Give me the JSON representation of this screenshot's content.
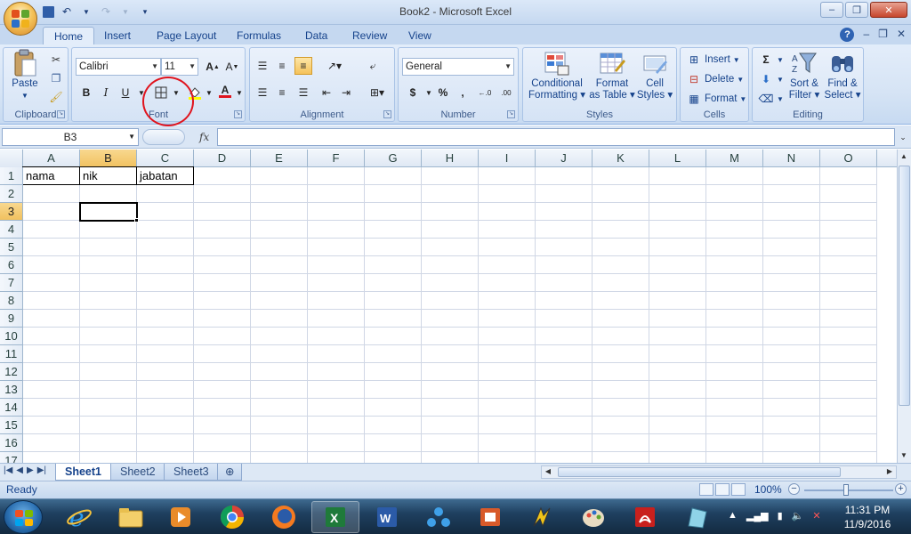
{
  "window": {
    "title": "Book2 - Microsoft Excel"
  },
  "ribbon_tabs": [
    "Home",
    "Insert",
    "Page Layout",
    "Formulas",
    "Data",
    "Review",
    "View"
  ],
  "clipboard": {
    "paste": "Paste",
    "label": "Clipboard"
  },
  "font": {
    "family": "Calibri",
    "size": "11",
    "label": "Font",
    "bold": "B",
    "italic": "I",
    "underline": "U",
    "font_color_letter": "A"
  },
  "alignment": {
    "label": "Alignment"
  },
  "number": {
    "format": "General",
    "label": "Number",
    "currency": "$",
    "percent": "%",
    "comma": ",",
    "inc_decimal": "+.0 .00",
    "dec_decimal": ".00 +.0"
  },
  "styles": {
    "label": "Styles",
    "conditional_line1": "Conditional",
    "conditional_line2": "Formatting",
    "format_table_line1": "Format",
    "format_table_line2": "as Table",
    "cell_styles_line1": "Cell",
    "cell_styles_line2": "Styles"
  },
  "cells": {
    "label": "Cells",
    "insert": "Insert",
    "delete": "Delete",
    "format": "Format"
  },
  "editing": {
    "label": "Editing",
    "sigma": "Σ",
    "sort_line1": "Sort &",
    "sort_line2": "Filter",
    "find_line1": "Find &",
    "find_line2": "Select"
  },
  "formula_bar": {
    "name_box": "B3",
    "fx": "fx",
    "formula": ""
  },
  "columns": [
    "A",
    "B",
    "C",
    "D",
    "E",
    "F",
    "G",
    "H",
    "I",
    "J",
    "K",
    "L",
    "M",
    "N",
    "O"
  ],
  "rows": [
    "1",
    "2",
    "3",
    "4",
    "5",
    "6",
    "7",
    "8",
    "9",
    "10",
    "11",
    "12",
    "13",
    "14",
    "15",
    "16",
    "17"
  ],
  "cell_values": {
    "A1": "nama",
    "B1": "nik",
    "C1": "jabatan"
  },
  "sheets": [
    "Sheet1",
    "Sheet2",
    "Sheet3"
  ],
  "active_sheet": "Sheet1",
  "status": {
    "ready": "Ready",
    "zoom": "100%"
  },
  "taskbar": {
    "time": "11:31 PM",
    "date": "11/9/2016"
  },
  "colors": {
    "accent": "#15428b",
    "selected_header": "#f1c15f",
    "annotation_circle": "#e0141e"
  }
}
